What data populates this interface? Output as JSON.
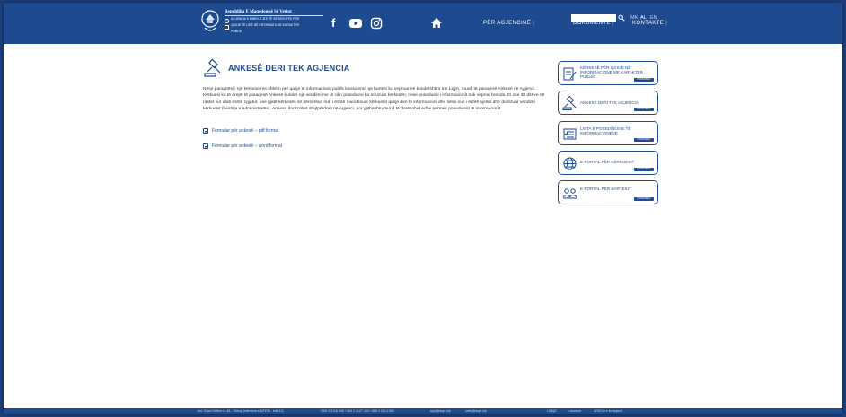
{
  "header": {
    "brand_title": "Republika E Maqedonisë Së Veriut",
    "brand_line1": "Agjencia e Mbrojtjes të së Drejtës për",
    "brand_line2": "qasje të lirë në informata me karakter",
    "brand_line3": "publik",
    "search": {
      "value": "",
      "placeholder": ""
    },
    "languages": [
      "MK",
      "AL",
      "EN"
    ],
    "nav": [
      {
        "label": "PËR AGJENCINË"
      },
      {
        "label": "DOKUMENTE"
      },
      {
        "label": "KONTAKTE"
      }
    ],
    "nav_separator": "|"
  },
  "main": {
    "title": "ANKESË DERI TEK AGJENCIA",
    "paragraph": "Nëse paraqitësi i një kërkese me shkrim për qasje të informacionit publik konsideron që bartësi ka vepruar në kundërshtim me Ligjin, mund të paraqesë Ankesë në Agjenci. Kërkuesi ka të drejtë të paraqesë Ankesë kunder një vendimi me të cilin poseduesi ka refuzuar kërkesën; nese poseduesi i informacionit nuk vepron brenda 20 ose 30 ditëve në rastet kur afati është zgjatur, ose gjatë kërkesës së përsëritur, nuk i është mundësuar kërkuesit qasje deri te informacioni dhe nëse nuk i është sjellur dhe dorëzuar vendimi kërkuesit (heshtja e administratës). Ankesa dorëzohet drejtpërdrejt në Agjenci, por gjithashtu mund të dorëzohet edhe përmes poseduesit të informacionit.",
    "links": [
      {
        "label": "Formular për ankesë – pdf format"
      },
      {
        "label": "Formular për ankesë – word format"
      }
    ]
  },
  "sidebar": {
    "cards": [
      {
        "label": "KËRKESË PËR QASJE NË INFORMACIONE ME KARAKTER PUBLIK",
        "button": "PODROBNO",
        "icon": "document-pen-icon"
      },
      {
        "label": "ANKESË DERI TEK AGJENCIA",
        "button": "PODROBNO",
        "icon": "gavel-icon"
      },
      {
        "label": "LISTA E POSEDUESVE TË INFORMACIONEVE",
        "button": "PODROBNO",
        "icon": "list-icon"
      },
      {
        "label": "E-PORTAL PËR KËRKUESIT",
        "button": "PODROBNO",
        "icon": "globe-icon"
      },
      {
        "label": "E-PORTAL PËR BARTËSIT",
        "button": "PODROBNO",
        "icon": "people-icon"
      }
    ]
  },
  "footer": {
    "address": "bul. Goce Delčev nr.18 - Shkup (ndertesa e MTRM - kati 14)",
    "phone": "+389 2 3118 038  +389 2 3127 453  +389 2 3114 655",
    "email1": "sppi@aspi.mk",
    "email2": "zafio@aspi.mk",
    "links": "LINQE",
    "location": "Lokacioni",
    "archive": "ARKIVA e kompjutrit"
  },
  "colors": {
    "primary": "#1e4a8f",
    "background": "#ffffff",
    "outer": "#1b3f7a"
  }
}
